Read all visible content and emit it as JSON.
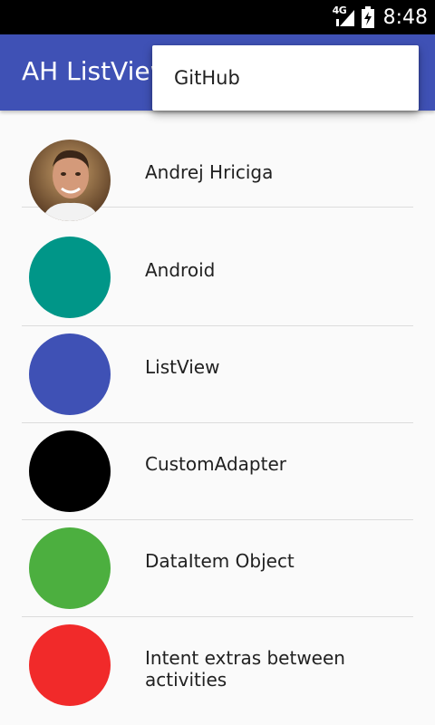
{
  "status_bar": {
    "network": "4G",
    "time": "8:48"
  },
  "app_bar": {
    "title": "AH ListView"
  },
  "overflow_menu": {
    "items": [
      {
        "label": "GitHub"
      }
    ]
  },
  "list": {
    "items": [
      {
        "label": "Andrej Hriciga",
        "avatar": "photo",
        "color": "#6a4a30"
      },
      {
        "label": "Android",
        "avatar": "circle",
        "color": "#009688"
      },
      {
        "label": "ListView",
        "avatar": "circle",
        "color": "#3f51b5"
      },
      {
        "label": "CustomAdapter",
        "avatar": "circle",
        "color": "#000000"
      },
      {
        "label": "DataItem Object",
        "avatar": "circle",
        "color": "#4caf3f"
      },
      {
        "label": "Intent extras between activities",
        "avatar": "circle",
        "color": "#f12a2a"
      }
    ]
  },
  "colors": {
    "primary": "#3f51b5",
    "background": "#fafafa",
    "divider": "#dcdcdc"
  }
}
